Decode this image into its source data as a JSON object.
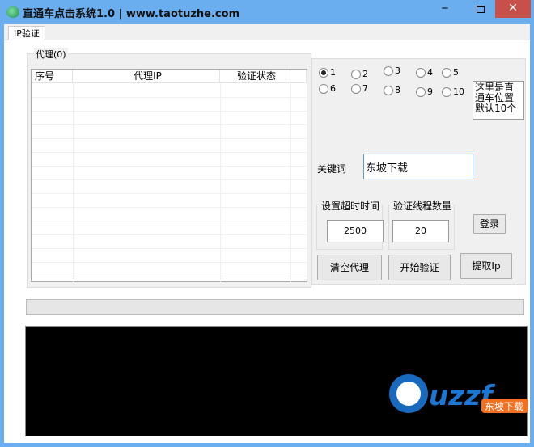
{
  "window": {
    "title": "直通车点击系统1.0 | www.taotuzhe.com",
    "minimize": "‒",
    "close": "✕"
  },
  "tabs": [
    {
      "label": "IP验证",
      "active": true
    }
  ],
  "proxy_group": {
    "label": "代理(0)",
    "columns": [
      "序号",
      "代理IP",
      "验证状态"
    ],
    "rows": []
  },
  "positions": {
    "options": [
      "1",
      "2",
      "3",
      "4",
      "5",
      "6",
      "7",
      "8",
      "9",
      "10"
    ],
    "selected": "1",
    "note": "这里是直通车位置默认10个"
  },
  "keyword": {
    "label": "关键词",
    "value": "东坡下载"
  },
  "timeout": {
    "label": "设置超时时间",
    "value": "2500"
  },
  "threads": {
    "label": "验证线程数量",
    "value": "20"
  },
  "buttons": {
    "login": "登录",
    "clear": "清空代理",
    "start": "开始验证",
    "fetch": "提取Ip"
  },
  "progress": {
    "value": 0
  },
  "watermark": {
    "text": "uzzf.com",
    "sub": "东坡下载"
  }
}
